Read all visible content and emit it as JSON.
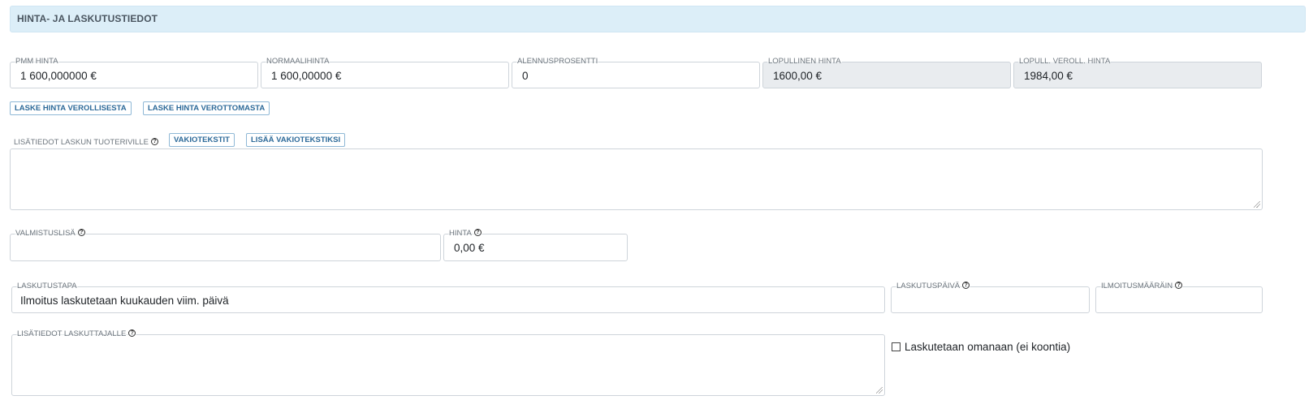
{
  "section": {
    "title": "HINTA- JA LASKUTUSTIEDOT"
  },
  "prices": {
    "pmm": {
      "label": "PMM HINTA",
      "value": "1 600,000000 €"
    },
    "normal": {
      "label": "NORMAALIHINTA",
      "value": "1 600,00000 €"
    },
    "discount": {
      "label": "ALENNUSPROSENTTI",
      "value": "0"
    },
    "final": {
      "label": "LOPULLINEN HINTA",
      "value": "1600,00 €"
    },
    "final_vat": {
      "label": "LOPULL. VEROLL. HINTA",
      "value": "1984,00 €"
    }
  },
  "buttons": {
    "calc_incl_vat": "LASKE HINTA VEROLLISESTA",
    "calc_excl_vat": "LASKE HINTA VEROTTOMASTA",
    "standard_texts": "VAKIOTEKSTIT",
    "add_standard_text": "LISÄÄ VAKIOTEKSTIKSI"
  },
  "invoice_line_info": {
    "label": "LISÄTIEDOT LASKUN TUOTERIVILLE",
    "value": ""
  },
  "manufacturing": {
    "label": "VALMISTUSLISÄ",
    "value": "",
    "price_label": "HINTA",
    "price_value": "0,00 €"
  },
  "billing": {
    "method_label": "LASKUTUSTAPA",
    "method_value": "Ilmoitus laskutetaan kuukauden viim. päivä",
    "date_label": "LASKUTUSPÄIVÄ",
    "date_value": "",
    "count_label": "ILMOITUSMÄÄRÄIN",
    "count_value": "",
    "biller_info_label": "LISÄTIEDOT LASKUTTAJALLE",
    "biller_info_value": "",
    "own_invoice_label": "Laskutetaan omanaan (ei koontia)",
    "own_invoice_checked": false
  },
  "icons": {
    "help": "question-circle-icon",
    "help_glyph": "?"
  }
}
